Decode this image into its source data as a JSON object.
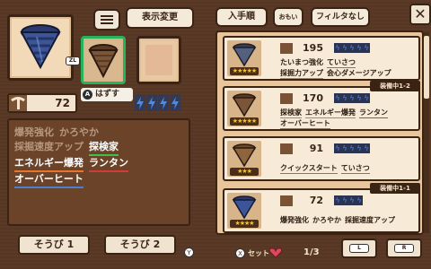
{
  "top_bar": {
    "display_change_label": "表示変更",
    "sort_order_label": "入手順",
    "heavy_label": "おもい",
    "filter_label": "フィルタなし",
    "close_glyph": "✕"
  },
  "selected": {
    "zl_badge": "ZL",
    "unequip_button_icon": "A",
    "unequip_label": "はずす",
    "power": "72",
    "energy_bolts": 4
  },
  "skills": [
    {
      "text": "爆発強化",
      "style": "dim",
      "underline": "none"
    },
    {
      "text": "かろやか",
      "style": "dim",
      "underline": "none"
    },
    {
      "text": "採掘速度アップ",
      "style": "dim",
      "underline": "none"
    },
    {
      "text": "探検家",
      "style": "white",
      "underline": "green"
    },
    {
      "text": "エネルギー爆発",
      "style": "white",
      "underline": "orange"
    },
    {
      "text": "ランタン",
      "style": "white",
      "underline": "red"
    },
    {
      "text": "オーバーヒート",
      "style": "white",
      "underline": "blue"
    }
  ],
  "loadouts": {
    "loadout_1": "そうび 1",
    "loadout_2": "そうび 2",
    "y_icon": "Y"
  },
  "drill_list": [
    {
      "power": "195",
      "stars": "★★★★★",
      "bolts": 5,
      "equipped": "",
      "skills": [
        {
          "text": "たいまつ強化",
          "underline": "none"
        },
        {
          "text": "ていさつ",
          "underline": "blue"
        },
        {
          "text": "採掘力アップ",
          "underline": "orange"
        },
        {
          "text": "会心ダメージアップ",
          "underline": "none"
        }
      ]
    },
    {
      "power": "170",
      "stars": "★★★★★",
      "bolts": 5,
      "equipped": "装備中1-2",
      "skills": [
        {
          "text": "探検家",
          "underline": "green"
        },
        {
          "text": "エネルギー爆発",
          "underline": "orange"
        },
        {
          "text": "ランタン",
          "underline": "red"
        },
        {
          "text": "オーバーヒート",
          "underline": "blue"
        }
      ]
    },
    {
      "power": "91",
      "stars": "★★★",
      "bolts": 5,
      "equipped": "",
      "skills": [
        {
          "text": "クイックスタート",
          "underline": "blue"
        },
        {
          "text": "ていさつ",
          "underline": "blue"
        }
      ]
    },
    {
      "power": "72",
      "stars": "★★★★",
      "bolts": 4,
      "equipped": "装備中1-1",
      "skills": [
        {
          "text": "爆発強化",
          "underline": "none"
        },
        {
          "text": "かろやか",
          "underline": "none"
        },
        {
          "text": "採掘速度アップ",
          "underline": "none"
        }
      ]
    }
  ],
  "bottom_bar": {
    "x_icon": "X",
    "set_label": "セット",
    "page": "1/3",
    "prev_button": "L",
    "next_button": "R"
  },
  "colors": {
    "background": "#5a3a26",
    "panel": "#e9c59b",
    "card": "#f7ead6",
    "accent_green": "#27b35a",
    "energy_blue": "#4b8be8",
    "star_gold": "#f7c431"
  },
  "icons": {
    "pickaxe": "pickaxe-icon",
    "bolt": "lightning-bolt-icon",
    "drill": "drill-icon",
    "heart": "heart-icon",
    "menu": "list-menu-icon"
  }
}
